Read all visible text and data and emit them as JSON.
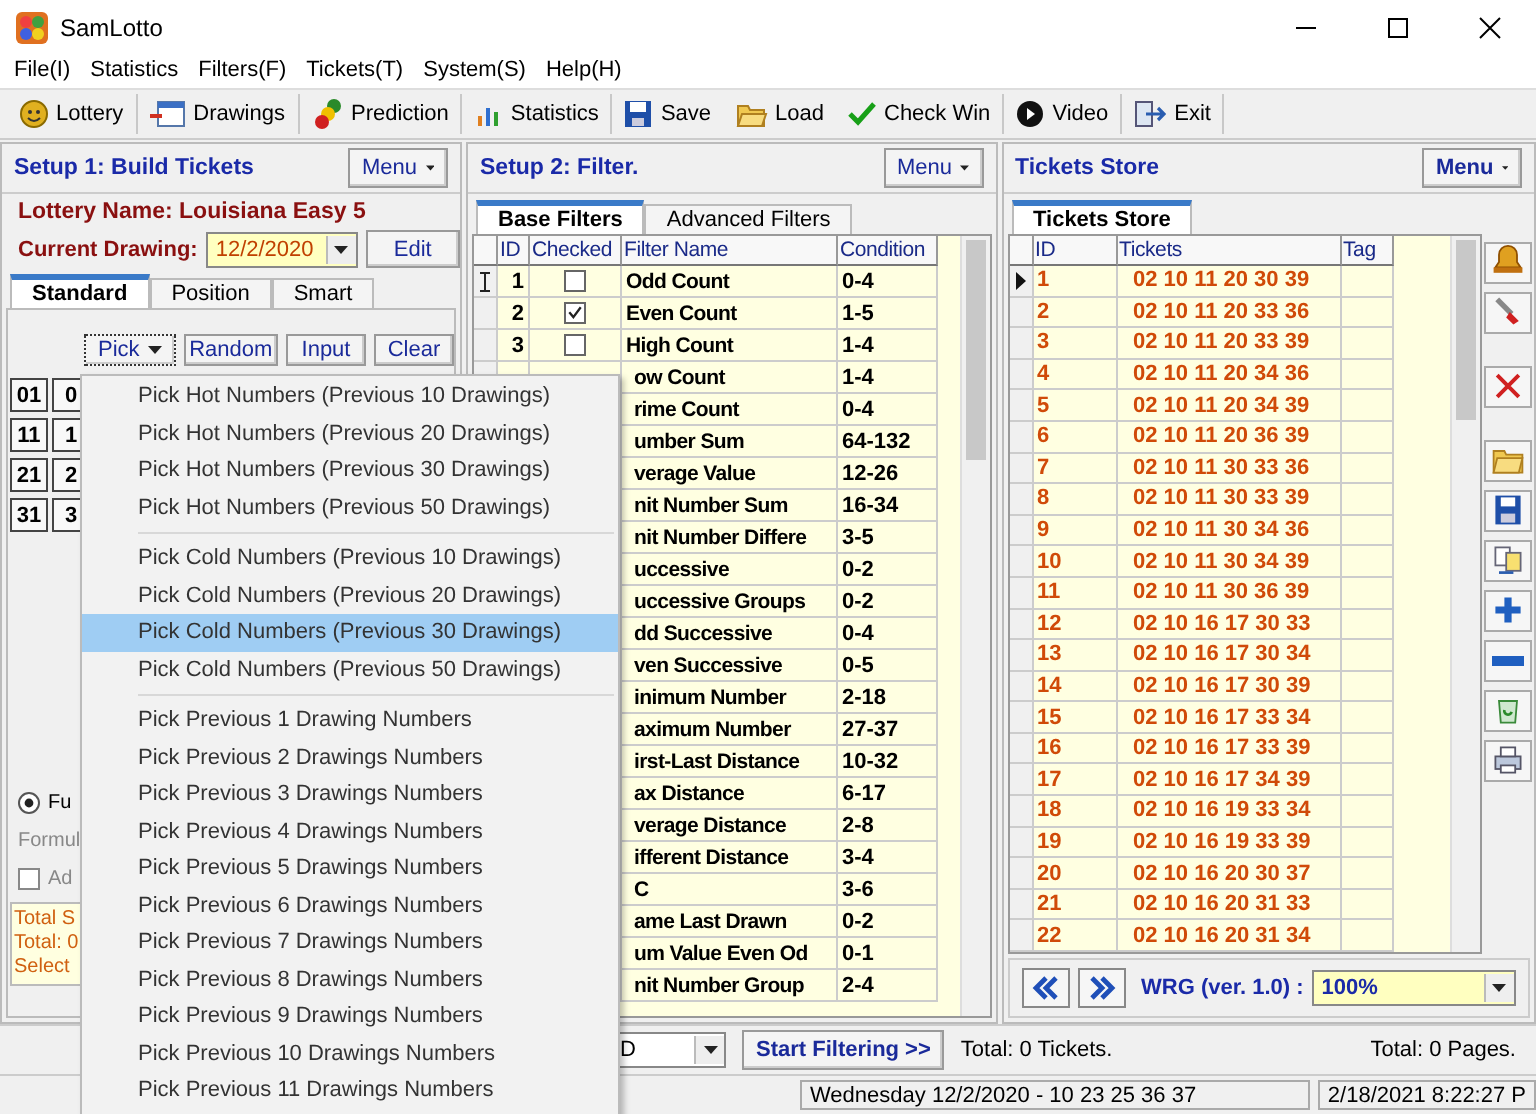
{
  "window": {
    "title": "SamLotto"
  },
  "menu_bar": [
    "File(I)",
    "Statistics",
    "Filters(F)",
    "Tickets(T)",
    "System(S)",
    "Help(H)"
  ],
  "toolbar": [
    {
      "kind": "lottery",
      "label": "Lottery"
    },
    {
      "kind": "drawings",
      "label": "Drawings"
    },
    {
      "kind": "prediction",
      "label": "Prediction"
    },
    {
      "kind": "statistics",
      "label": "Statistics"
    },
    {
      "kind": "save",
      "label": "Save"
    },
    {
      "kind": "load",
      "label": "Load"
    },
    {
      "kind": "check",
      "label": "Check Win"
    },
    {
      "kind": "video",
      "label": "Video"
    },
    {
      "kind": "exit",
      "label": "Exit"
    }
  ],
  "build_panel": {
    "title": "Setup 1: Build  Tickets",
    "menu_button": "Menu",
    "lottery_name": "Lottery  Name: Louisiana Easy 5",
    "current_drawing_label": "Current Drawing:",
    "current_drawing": "12/2/2020",
    "edit_button": "Edit",
    "tabs": [
      {
        "label": "Standard",
        "selected": true
      },
      {
        "label": "Position",
        "selected": false
      },
      {
        "label": "Smart",
        "selected": false
      }
    ],
    "pick_buttons": [
      {
        "kind": "dropdown",
        "label": "Pick"
      },
      {
        "kind": "plain",
        "label": "Random"
      },
      {
        "kind": "plain",
        "label": "Input"
      },
      {
        "kind": "plain",
        "label": "Clear"
      }
    ],
    "number_grid": [
      [
        "01",
        "0"
      ],
      [
        "11",
        "1"
      ],
      [
        "21",
        "2"
      ],
      [
        "31",
        "3"
      ]
    ],
    "mode_option": {
      "label": "Fu",
      "selected": true
    },
    "formula_label": "Formul",
    "add_option": {
      "label": "Ad",
      "checked": false
    },
    "totals": [
      "Total S",
      "Total: 0",
      "Select"
    ]
  },
  "filter_panel": {
    "title": "Setup 2: Filter.",
    "menu_button": "Menu",
    "tabs": [
      {
        "label": "Base Filters",
        "selected": true
      },
      {
        "label": "Advanced Filters",
        "selected": false
      }
    ],
    "columns": [
      "ID",
      "Checked",
      "Filter Name",
      "Condition"
    ],
    "rows": [
      {
        "current": true,
        "id": "1",
        "checked": false,
        "name": "Odd Count",
        "condition": "0-4"
      },
      {
        "current": false,
        "id": "2",
        "checked": true,
        "name": "Even Count",
        "condition": "1-5"
      },
      {
        "current": false,
        "id": "3",
        "checked": false,
        "name": "High Count",
        "condition": "1-4"
      },
      {
        "name": "ow Count",
        "condition": "1-4"
      },
      {
        "name": "rime Count",
        "condition": "0-4"
      },
      {
        "name": "umber Sum",
        "condition": "64-132"
      },
      {
        "name": "verage Value",
        "condition": "12-26"
      },
      {
        "name": "nit Number Sum",
        "condition": "16-34"
      },
      {
        "name": "nit Number Differe",
        "condition": "3-5"
      },
      {
        "name": "uccessive",
        "condition": "0-2"
      },
      {
        "name": "uccessive Groups",
        "condition": "0-2"
      },
      {
        "name": "dd Successive",
        "condition": "0-4"
      },
      {
        "name": "ven Successive",
        "condition": "0-5"
      },
      {
        "name": "inimum Number",
        "condition": "2-18"
      },
      {
        "name": "aximum Number",
        "condition": "27-37"
      },
      {
        "name": "irst-Last Distance",
        "condition": "10-32"
      },
      {
        "name": "ax Distance",
        "condition": "6-17"
      },
      {
        "name": "verage Distance",
        "condition": "2-8"
      },
      {
        "name": "ifferent Distance",
        "condition": "3-4"
      },
      {
        "name": "C",
        "condition": "3-6"
      },
      {
        "name": "ame Last Drawn",
        "condition": "0-2"
      },
      {
        "name": "um Value Even Od",
        "condition": "0-1"
      },
      {
        "name": "nit Number Group",
        "condition": "2-4"
      }
    ],
    "sort_field": "D",
    "start_button": "Start Filtering >>",
    "total": "Total: 0 Tickets."
  },
  "tickets_panel": {
    "title": "Tickets Store",
    "menu_button": "Menu",
    "tabs": [
      {
        "label": "Tickets Store",
        "selected": true
      }
    ],
    "columns": [
      "ID",
      "Tickets",
      "Tag"
    ],
    "rows": [
      {
        "selected": true,
        "id": "1",
        "tickets": "02 10 11 20 30 39"
      },
      {
        "selected": false,
        "id": "2",
        "tickets": "02 10 11 20 33 36"
      },
      {
        "selected": false,
        "id": "3",
        "tickets": "02 10 11 20 33 39"
      },
      {
        "selected": false,
        "id": "4",
        "tickets": "02 10 11 20 34 36"
      },
      {
        "selected": false,
        "id": "5",
        "tickets": "02 10 11 20 34 39"
      },
      {
        "selected": false,
        "id": "6",
        "tickets": "02 10 11 20 36 39"
      },
      {
        "selected": false,
        "id": "7",
        "tickets": "02 10 11 30 33 36"
      },
      {
        "selected": false,
        "id": "8",
        "tickets": "02 10 11 30 33 39"
      },
      {
        "selected": false,
        "id": "9",
        "tickets": "02 10 11 30 34 36"
      },
      {
        "selected": false,
        "id": "10",
        "tickets": "02 10 11 30 34 39"
      },
      {
        "selected": false,
        "id": "11",
        "tickets": "02 10 11 30 36 39"
      },
      {
        "selected": false,
        "id": "12",
        "tickets": "02 10 16 17 30 33"
      },
      {
        "selected": false,
        "id": "13",
        "tickets": "02 10 16 17 30 34"
      },
      {
        "selected": false,
        "id": "14",
        "tickets": "02 10 16 17 30 39"
      },
      {
        "selected": false,
        "id": "15",
        "tickets": "02 10 16 17 33 34"
      },
      {
        "selected": false,
        "id": "16",
        "tickets": "02 10 16 17 33 39"
      },
      {
        "selected": false,
        "id": "17",
        "tickets": "02 10 16 17 34 39"
      },
      {
        "selected": false,
        "id": "18",
        "tickets": "02 10 16 19 33 34"
      },
      {
        "selected": false,
        "id": "19",
        "tickets": "02 10 16 19 33 39"
      },
      {
        "selected": false,
        "id": "20",
        "tickets": "02 10 16 20 30 37"
      },
      {
        "selected": false,
        "id": "21",
        "tickets": "02 10 16 20 31 33"
      },
      {
        "selected": false,
        "id": "22",
        "tickets": "02 10 16 20 31 34"
      }
    ],
    "generator_label": "WRG (ver. 1.0) :",
    "zoom": "100%",
    "pages": "Total: 0 Pages."
  },
  "status_bar": {
    "last_drawing": "Wednesday 12/2/2020 - 10 23 25 36 37",
    "clock": "2/18/2021 8:22:27 P"
  },
  "pick_menu": {
    "items": [
      {
        "kind": "item",
        "label": "Pick Hot Numbers (Previous 10 Drawings)",
        "selected": false
      },
      {
        "kind": "item",
        "label": "Pick Hot Numbers (Previous 20 Drawings)",
        "selected": false
      },
      {
        "kind": "item",
        "label": "Pick Hot Numbers (Previous 30 Drawings)",
        "selected": false
      },
      {
        "kind": "item",
        "label": "Pick Hot Numbers (Previous 50 Drawings)",
        "selected": false
      },
      {
        "kind": "separator"
      },
      {
        "kind": "item",
        "label": "Pick Cold Numbers (Previous 10 Drawings)",
        "selected": false
      },
      {
        "kind": "item",
        "label": "Pick Cold Numbers (Previous 20 Drawings)",
        "selected": false
      },
      {
        "kind": "item",
        "label": "Pick Cold Numbers (Previous 30 Drawings)",
        "selected": true
      },
      {
        "kind": "item",
        "label": "Pick Cold Numbers (Previous 50 Drawings)",
        "selected": false
      },
      {
        "kind": "separator"
      },
      {
        "kind": "item",
        "label": "Pick Previous 1 Drawing Numbers",
        "selected": false
      },
      {
        "kind": "item",
        "label": "Pick Previous 2 Drawings Numbers",
        "selected": false
      },
      {
        "kind": "item",
        "label": "Pick Previous 3 Drawings Numbers",
        "selected": false
      },
      {
        "kind": "item",
        "label": "Pick Previous 4 Drawings Numbers",
        "selected": false
      },
      {
        "kind": "item",
        "label": "Pick Previous 5 Drawings Numbers",
        "selected": false
      },
      {
        "kind": "item",
        "label": "Pick Previous 6 Drawings Numbers",
        "selected": false
      },
      {
        "kind": "item",
        "label": "Pick Previous 7 Drawings Numbers",
        "selected": false
      },
      {
        "kind": "item",
        "label": "Pick Previous 8 Drawings Numbers",
        "selected": false
      },
      {
        "kind": "item",
        "label": "Pick Previous 9 Drawings Numbers",
        "selected": false
      },
      {
        "kind": "item",
        "label": "Pick Previous 10 Drawings Numbers",
        "selected": false
      },
      {
        "kind": "item",
        "label": "Pick Previous 11 Drawings Numbers",
        "selected": false
      }
    ]
  }
}
